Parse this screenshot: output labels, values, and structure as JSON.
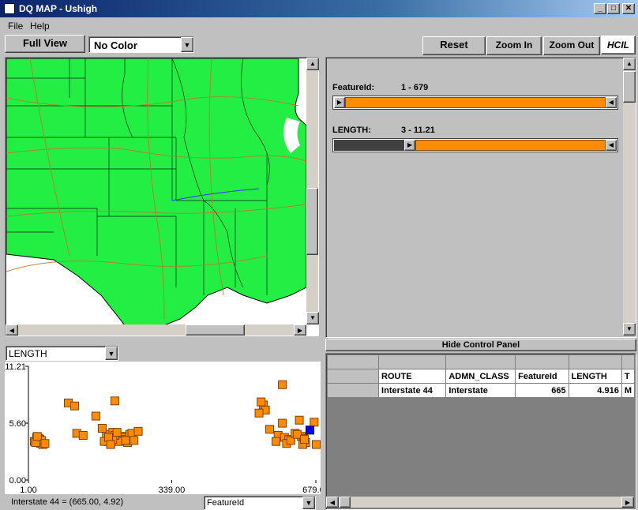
{
  "window": {
    "title": "DQ MAP - Ushigh"
  },
  "menu": [
    "File",
    "Help"
  ],
  "toolbar": {
    "full_view": "Full View",
    "color_select": "No Color",
    "reset": "Reset",
    "zoom_in": "Zoom In",
    "zoom_out": "Zoom Out",
    "logo": "HCIL"
  },
  "sliders": [
    {
      "label": "FeatureId:",
      "range_text": "1 - 679",
      "low_fraction": 0.0,
      "high_fraction": 1.0
    },
    {
      "label": "LENGTH:",
      "range_text": "3 - 11.21",
      "low_fraction": 0.27,
      "high_fraction": 1.0
    }
  ],
  "hide_panel": "Hide Control Panel",
  "table": {
    "columns": [
      "ROUTE",
      "ADMN_CLASS",
      "FeatureId",
      "LENGTH",
      "T"
    ],
    "rows": [
      [
        "Interstate  44",
        "Interstate",
        "665",
        "4.916",
        "M"
      ]
    ]
  },
  "scatter": {
    "y_select": "LENGTH",
    "x_select": "FeatureId",
    "status": "Interstate  44 = (665.00, 4.92)",
    "y_ticks": [
      "11.21",
      "5.60",
      "0.00"
    ],
    "x_ticks": [
      "1.00",
      "339.00",
      "679.00"
    ],
    "colors": {
      "point": "#ff8c00",
      "selected": "#0000ff"
    }
  },
  "chart_data": {
    "type": "scatter",
    "xlabel": "FeatureId",
    "ylabel": "LENGTH",
    "xlim": [
      1,
      679
    ],
    "ylim": [
      0,
      11.21
    ],
    "x": [
      25,
      30,
      15,
      20,
      35,
      28,
      32,
      18,
      22,
      40,
      115,
      130,
      95,
      110,
      205,
      185,
      200,
      190,
      210,
      220,
      195,
      180,
      225,
      230,
      235,
      240,
      245,
      250,
      215,
      205,
      200,
      190,
      195,
      210,
      230,
      260,
      555,
      560,
      600,
      570,
      590,
      585,
      605,
      615,
      610,
      620,
      640,
      645,
      650,
      655,
      630,
      635,
      648,
      652,
      665,
      675,
      680,
      160,
      175,
      600,
      550,
      545
    ],
    "y": [
      4.1,
      3.6,
      3.8,
      4.2,
      3.5,
      4.0,
      3.9,
      3.7,
      4.3,
      3.6,
      4.6,
      4.4,
      7.6,
      7.3,
      7.8,
      4.5,
      4.7,
      3.8,
      4.1,
      4.3,
      3.6,
      3.8,
      4.2,
      4.0,
      3.7,
      4.5,
      4.6,
      3.9,
      3.8,
      4.4,
      4.0,
      4.2,
      3.5,
      4.7,
      3.9,
      4.8,
      7.4,
      6.9,
      5.6,
      5.0,
      4.4,
      3.8,
      4.2,
      4.0,
      3.6,
      3.9,
      5.9,
      4.3,
      4.1,
      3.7,
      4.6,
      4.5,
      3.5,
      4.0,
      4.92,
      5.7,
      3.5,
      6.3,
      5.1,
      9.4,
      7.7,
      6.6
    ],
    "selected": {
      "x": 665,
      "y": 4.92
    }
  }
}
